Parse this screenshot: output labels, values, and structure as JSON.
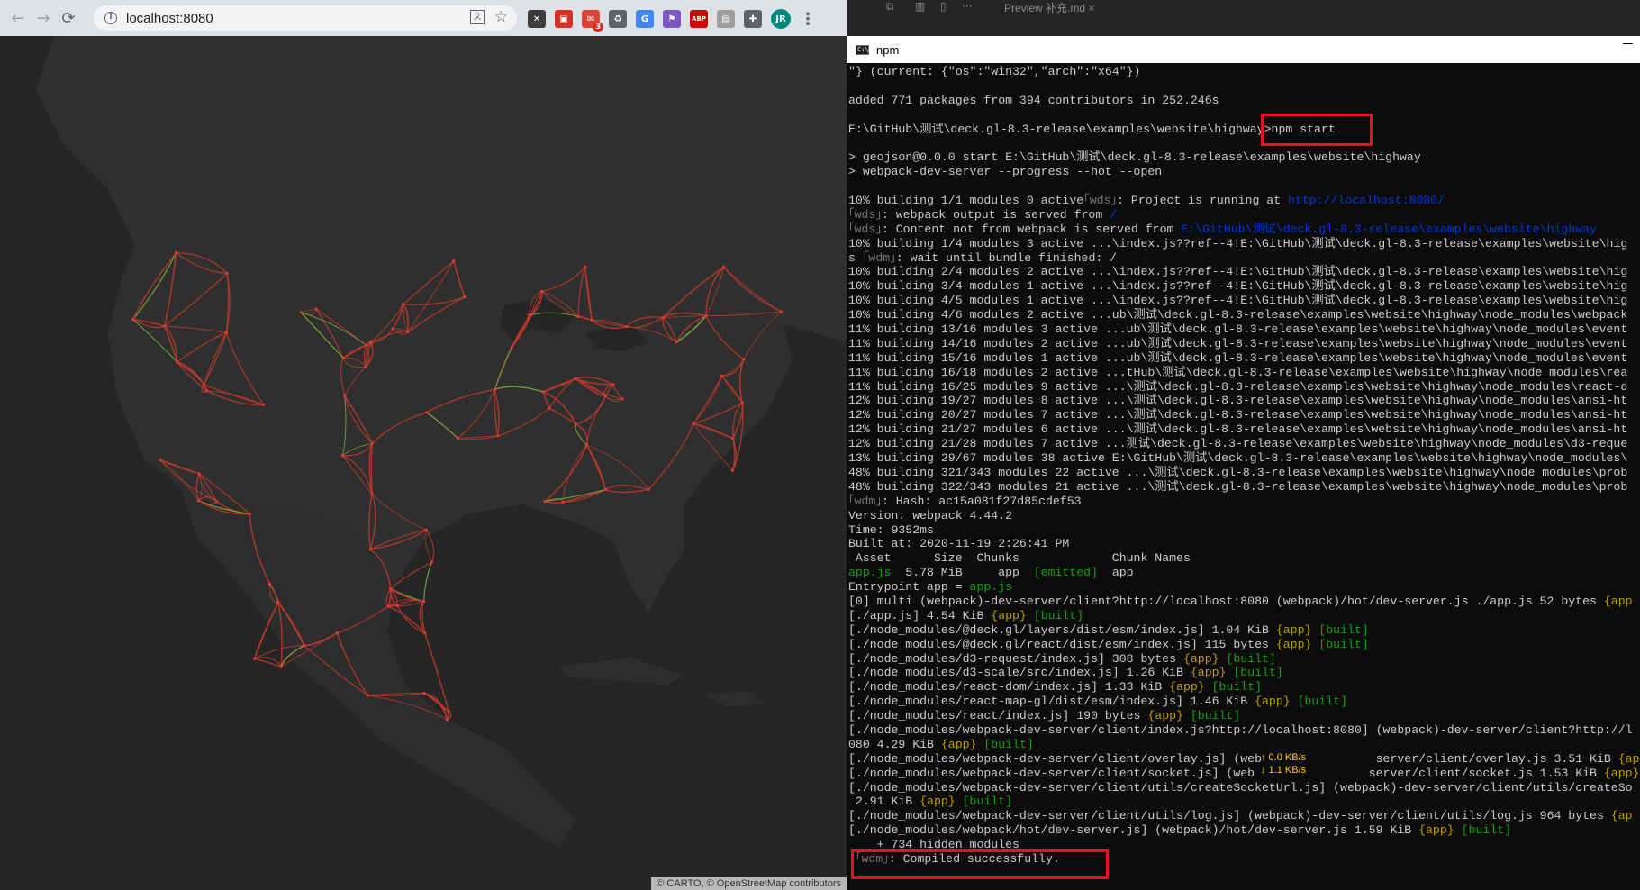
{
  "browser": {
    "url": "localhost:8080",
    "nav": {
      "back": "←",
      "forward": "→",
      "reload": "⟳"
    },
    "info_glyph": "i",
    "translate_glyph": "文",
    "star_glyph": "☆",
    "extensions": [
      {
        "name": "x-ext",
        "glyph": "✕",
        "color": "#3c3c3c"
      },
      {
        "name": "red-ext",
        "glyph": "▣",
        "color": "#d93025"
      },
      {
        "name": "mail-ext",
        "glyph": "✉",
        "color": "#db4437",
        "badge": "3"
      },
      {
        "name": "recycle-ext",
        "glyph": "♻",
        "color": "#5f6368"
      },
      {
        "name": "translate-ext",
        "glyph": "G",
        "color": "#4285f4"
      },
      {
        "name": "flag-ext",
        "glyph": "⚑",
        "color": "#7e57c2"
      },
      {
        "name": "abp-ext",
        "glyph": "ABP",
        "color": "#d50000"
      },
      {
        "name": "gray-ext",
        "glyph": "▤",
        "color": "#9e9e9e"
      },
      {
        "name": "puzzle-ext",
        "glyph": "✚",
        "color": "#5f6368"
      }
    ],
    "avatar": "JR",
    "menu": "⋮",
    "attribution": "© CARTO, © OpenStreetMap contributors"
  },
  "editor": {
    "preview_tab": "Preview 补充.md",
    "close_glyph": "×",
    "more_glyph": "···"
  },
  "terminal": {
    "title": "npm",
    "icon_text": "C:\\",
    "lines": [
      {
        "segs": [
          {
            "t": "\"} (current: {\"os\":\"win32\",\"arch\":\"x64\"})",
            "c": "c-w"
          }
        ]
      },
      {
        "segs": [
          {
            "t": "",
            "c": "c-w"
          }
        ]
      },
      {
        "segs": [
          {
            "t": "added 771 packages from 394 contributors in 252.246s",
            "c": "c-w"
          }
        ]
      },
      {
        "segs": [
          {
            "t": "",
            "c": "c-w"
          }
        ]
      },
      {
        "segs": [
          {
            "t": "E:\\GitHub\\测试\\deck.gl-8.3-release\\examples\\website\\highway>npm start",
            "c": "c-w"
          }
        ]
      },
      {
        "segs": [
          {
            "t": "",
            "c": "c-w"
          }
        ]
      },
      {
        "segs": [
          {
            "t": "> geojson@0.0.0 start E:\\GitHub\\测试\\deck.gl-8.3-release\\examples\\website\\highway",
            "c": "c-w"
          }
        ]
      },
      {
        "segs": [
          {
            "t": "> webpack-dev-server --progress --hot --open",
            "c": "c-w"
          }
        ]
      },
      {
        "segs": [
          {
            "t": "",
            "c": "c-w"
          }
        ]
      },
      {
        "segs": [
          {
            "t": "10% building 1/1 modules 0 active",
            "c": "c-w"
          },
          {
            "t": "｢wds｣",
            "c": "c-dim"
          },
          {
            "t": ": Project is running at ",
            "c": "c-w"
          },
          {
            "t": "http://localhost:8080/",
            "c": "c-bd"
          }
        ]
      },
      {
        "segs": [
          {
            "t": "｢wds｣",
            "c": "c-dim"
          },
          {
            "t": ": webpack output is served from ",
            "c": "c-w"
          },
          {
            "t": "/",
            "c": "c-bd"
          }
        ]
      },
      {
        "segs": [
          {
            "t": "｢wds｣",
            "c": "c-dim"
          },
          {
            "t": ": Content not from webpack is served from ",
            "c": "c-w"
          },
          {
            "t": "E:\\GitHub\\测试\\deck.gl-8.3-release\\examples\\website\\highway",
            "c": "c-bd"
          }
        ]
      },
      {
        "segs": [
          {
            "t": "10% building 1/4 modules 3 active ...\\index.js??ref--4!E:\\GitHub\\测试\\deck.gl-8.3-release\\examples\\website\\hig",
            "c": "c-w"
          }
        ]
      },
      {
        "segs": [
          {
            "t": "s ",
            "c": "c-w"
          },
          {
            "t": "｢wdm｣",
            "c": "c-dim"
          },
          {
            "t": ": wait until bundle finished: /",
            "c": "c-w"
          }
        ]
      },
      {
        "segs": [
          {
            "t": "10% building 2/4 modules 2 active ...\\index.js??ref--4!E:\\GitHub\\测试\\deck.gl-8.3-release\\examples\\website\\hig",
            "c": "c-w"
          }
        ]
      },
      {
        "segs": [
          {
            "t": "10% building 3/4 modules 1 active ...\\index.js??ref--4!E:\\GitHub\\测试\\deck.gl-8.3-release\\examples\\website\\hig",
            "c": "c-w"
          }
        ]
      },
      {
        "segs": [
          {
            "t": "10% building 4/5 modules 1 active ...\\index.js??ref--4!E:\\GitHub\\测试\\deck.gl-8.3-release\\examples\\website\\hig",
            "c": "c-w"
          }
        ]
      },
      {
        "segs": [
          {
            "t": "10% building 4/6 modules 2 active ...ub\\测试\\deck.gl-8.3-release\\examples\\website\\highway\\node_modules\\webpack",
            "c": "c-w"
          }
        ]
      },
      {
        "segs": [
          {
            "t": "11% building 13/16 modules 3 active ...ub\\测试\\deck.gl-8.3-release\\examples\\website\\highway\\node_modules\\event",
            "c": "c-w"
          }
        ]
      },
      {
        "segs": [
          {
            "t": "11% building 14/16 modules 2 active ...ub\\测试\\deck.gl-8.3-release\\examples\\website\\highway\\node_modules\\event",
            "c": "c-w"
          }
        ]
      },
      {
        "segs": [
          {
            "t": "11% building 15/16 modules 1 active ...ub\\测试\\deck.gl-8.3-release\\examples\\website\\highway\\node_modules\\event",
            "c": "c-w"
          }
        ]
      },
      {
        "segs": [
          {
            "t": "11% building 16/18 modules 2 active ...tHub\\测试\\deck.gl-8.3-release\\examples\\website\\highway\\node_modules\\rea",
            "c": "c-w"
          }
        ]
      },
      {
        "segs": [
          {
            "t": "11% building 16/25 modules 9 active ...\\测试\\deck.gl-8.3-release\\examples\\website\\highway\\node_modules\\react-d",
            "c": "c-w"
          }
        ]
      },
      {
        "segs": [
          {
            "t": "12% building 19/27 modules 8 active ...\\测试\\deck.gl-8.3-release\\examples\\website\\highway\\node_modules\\ansi-ht",
            "c": "c-w"
          }
        ]
      },
      {
        "segs": [
          {
            "t": "12% building 20/27 modules 7 active ...\\测试\\deck.gl-8.3-release\\examples\\website\\highway\\node_modules\\ansi-ht",
            "c": "c-w"
          }
        ]
      },
      {
        "segs": [
          {
            "t": "12% building 21/27 modules 6 active ...\\测试\\deck.gl-8.3-release\\examples\\website\\highway\\node_modules\\ansi-ht",
            "c": "c-w"
          }
        ]
      },
      {
        "segs": [
          {
            "t": "12% building 21/28 modules 7 active ...测试\\deck.gl-8.3-release\\examples\\website\\highway\\node_modules\\d3-reque",
            "c": "c-w"
          }
        ]
      },
      {
        "segs": [
          {
            "t": "13% building 29/67 modules 38 active E:\\GitHub\\测试\\deck.gl-8.3-release\\examples\\website\\highway\\node_modules\\",
            "c": "c-w"
          }
        ]
      },
      {
        "segs": [
          {
            "t": "48% building 321/343 modules 22 active ...\\测试\\deck.gl-8.3-release\\examples\\website\\highway\\node_modules\\prob",
            "c": "c-w"
          }
        ]
      },
      {
        "segs": [
          {
            "t": "48% building 322/343 modules 21 active ...\\测试\\deck.gl-8.3-release\\examples\\website\\highway\\node_modules\\prob",
            "c": "c-w"
          }
        ]
      },
      {
        "segs": [
          {
            "t": "｢wdm｣",
            "c": "c-dim"
          },
          {
            "t": ": Hash: ac15a081f27d85cdef53",
            "c": "c-w"
          }
        ]
      },
      {
        "segs": [
          {
            "t": "Version: webpack 4.44.2",
            "c": "c-w"
          }
        ]
      },
      {
        "segs": [
          {
            "t": "Time: 9352ms",
            "c": "c-w"
          }
        ]
      },
      {
        "segs": [
          {
            "t": "Built at: 2020-11-19 2:26:41 PM",
            "c": "c-w"
          }
        ]
      },
      {
        "segs": [
          {
            "t": " Asset      Size  Chunks             Chunk Names",
            "c": "c-w"
          }
        ]
      },
      {
        "segs": [
          {
            "t": "app.js",
            "c": "c-g"
          },
          {
            "t": "  5.78 MiB     app  ",
            "c": "c-w"
          },
          {
            "t": "[emitted]",
            "c": "c-g"
          },
          {
            "t": "  app",
            "c": "c-w"
          }
        ]
      },
      {
        "segs": [
          {
            "t": "Entrypoint app = ",
            "c": "c-w"
          },
          {
            "t": "app.js",
            "c": "c-g"
          }
        ]
      },
      {
        "segs": [
          {
            "t": "[0] multi (webpack)-dev-server/client?http://localhost:8080 (webpack)/hot/dev-server.js ./app.js 52 bytes ",
            "c": "c-w"
          },
          {
            "t": "{app",
            "c": "c-y"
          }
        ]
      },
      {
        "segs": [
          {
            "t": "[./app.js] 4.54 KiB ",
            "c": "c-w"
          },
          {
            "t": "{app}",
            "c": "c-y"
          },
          {
            "t": " ",
            "c": "c-w"
          },
          {
            "t": "[built]",
            "c": "c-g"
          }
        ]
      },
      {
        "segs": [
          {
            "t": "[./node_modules/@deck.gl/layers/dist/esm/index.js] 1.04 KiB ",
            "c": "c-w"
          },
          {
            "t": "{app}",
            "c": "c-y"
          },
          {
            "t": " ",
            "c": "c-w"
          },
          {
            "t": "[built]",
            "c": "c-g"
          }
        ]
      },
      {
        "segs": [
          {
            "t": "[./node_modules/@deck.gl/react/dist/esm/index.js] 115 bytes ",
            "c": "c-w"
          },
          {
            "t": "{app}",
            "c": "c-y"
          },
          {
            "t": " ",
            "c": "c-w"
          },
          {
            "t": "[built]",
            "c": "c-g"
          }
        ]
      },
      {
        "segs": [
          {
            "t": "[./node_modules/d3-request/index.js] 308 bytes ",
            "c": "c-w"
          },
          {
            "t": "{app}",
            "c": "c-y"
          },
          {
            "t": " ",
            "c": "c-w"
          },
          {
            "t": "[built]",
            "c": "c-g"
          }
        ]
      },
      {
        "segs": [
          {
            "t": "[./node_modules/d3-scale/src/index.js] 1.26 KiB ",
            "c": "c-w"
          },
          {
            "t": "{app}",
            "c": "c-y"
          },
          {
            "t": " ",
            "c": "c-w"
          },
          {
            "t": "[built]",
            "c": "c-g"
          }
        ]
      },
      {
        "segs": [
          {
            "t": "[./node_modules/react-dom/index.js] 1.33 KiB ",
            "c": "c-w"
          },
          {
            "t": "{app}",
            "c": "c-y"
          },
          {
            "t": " ",
            "c": "c-w"
          },
          {
            "t": "[built]",
            "c": "c-g"
          }
        ]
      },
      {
        "segs": [
          {
            "t": "[./node_modules/react-map-gl/dist/esm/index.js] 1.46 KiB ",
            "c": "c-w"
          },
          {
            "t": "{app}",
            "c": "c-y"
          },
          {
            "t": " ",
            "c": "c-w"
          },
          {
            "t": "[built]",
            "c": "c-g"
          }
        ]
      },
      {
        "segs": [
          {
            "t": "[./node_modules/react/index.js] 190 bytes ",
            "c": "c-w"
          },
          {
            "t": "{app}",
            "c": "c-y"
          },
          {
            "t": " ",
            "c": "c-w"
          },
          {
            "t": "[built]",
            "c": "c-g"
          }
        ]
      },
      {
        "segs": [
          {
            "t": "[./node_modules/webpack-dev-server/client/index.js?http://localhost:8080] (webpack)-dev-server/client?http://l",
            "c": "c-w"
          }
        ]
      },
      {
        "segs": [
          {
            "t": "080 4.29 KiB ",
            "c": "c-w"
          },
          {
            "t": "{app}",
            "c": "c-y"
          },
          {
            "t": " ",
            "c": "c-w"
          },
          {
            "t": "[built]",
            "c": "c-g"
          }
        ]
      },
      {
        "segs": [
          {
            "t": "[./node_modules/webpack-dev-server/client/overlay.js] (web",
            "c": "c-w"
          },
          {
            "t": "                ",
            "c": "c-w"
          },
          {
            "t": "server/client/overlay.js 3.51 KiB ",
            "c": "c-w"
          },
          {
            "t": "{app}",
            "c": "c-y"
          },
          {
            "t": " [b",
            "c": "c-g"
          }
        ]
      },
      {
        "segs": [
          {
            "t": "[./node_modules/webpack-dev-server/client/socket.js] (web",
            "c": "c-w"
          },
          {
            "t": "                ",
            "c": "c-w"
          },
          {
            "t": "server/client/socket.js 1.53 KiB ",
            "c": "c-w"
          },
          {
            "t": "{app}",
            "c": "c-y"
          },
          {
            "t": " [bui",
            "c": "c-g"
          }
        ]
      },
      {
        "segs": [
          {
            "t": "[./node_modules/webpack-dev-server/client/utils/createSocketUrl.js] (webpack)-dev-server/client/utils/createSo",
            "c": "c-w"
          }
        ]
      },
      {
        "segs": [
          {
            "t": " 2.91 KiB ",
            "c": "c-w"
          },
          {
            "t": "{app}",
            "c": "c-y"
          },
          {
            "t": " ",
            "c": "c-w"
          },
          {
            "t": "[built]",
            "c": "c-g"
          }
        ]
      },
      {
        "segs": [
          {
            "t": "[./node_modules/webpack-dev-server/client/utils/log.js] (webpack)-dev-server/client/utils/log.js 964 bytes ",
            "c": "c-w"
          },
          {
            "t": "{ap",
            "c": "c-y"
          }
        ]
      },
      {
        "segs": [
          {
            "t": "[./node_modules/webpack/hot/dev-server.js] (webpack)/hot/dev-server.js 1.59 KiB ",
            "c": "c-w"
          },
          {
            "t": "{app}",
            "c": "c-y"
          },
          {
            "t": " ",
            "c": "c-w"
          },
          {
            "t": "[built]",
            "c": "c-g"
          }
        ]
      },
      {
        "segs": [
          {
            "t": "    + 734 hidden modules",
            "c": "c-w"
          }
        ]
      },
      {
        "segs": [
          {
            "t": " ",
            "c": "c-w"
          },
          {
            "t": "｢wdm｣",
            "c": "c-dim"
          },
          {
            "t": ": Compiled successfully.",
            "c": "c-w"
          }
        ]
      }
    ]
  },
  "network_overlay": {
    "up": "↑ 0.0 KB/s",
    "down": "↓ 1.1 KB/s"
  },
  "colors": {
    "highlight": "#e81123",
    "road": "#c0392b",
    "road_alt": "#7cb342",
    "map_bg": "#262626",
    "land": "#2e2e2e"
  }
}
